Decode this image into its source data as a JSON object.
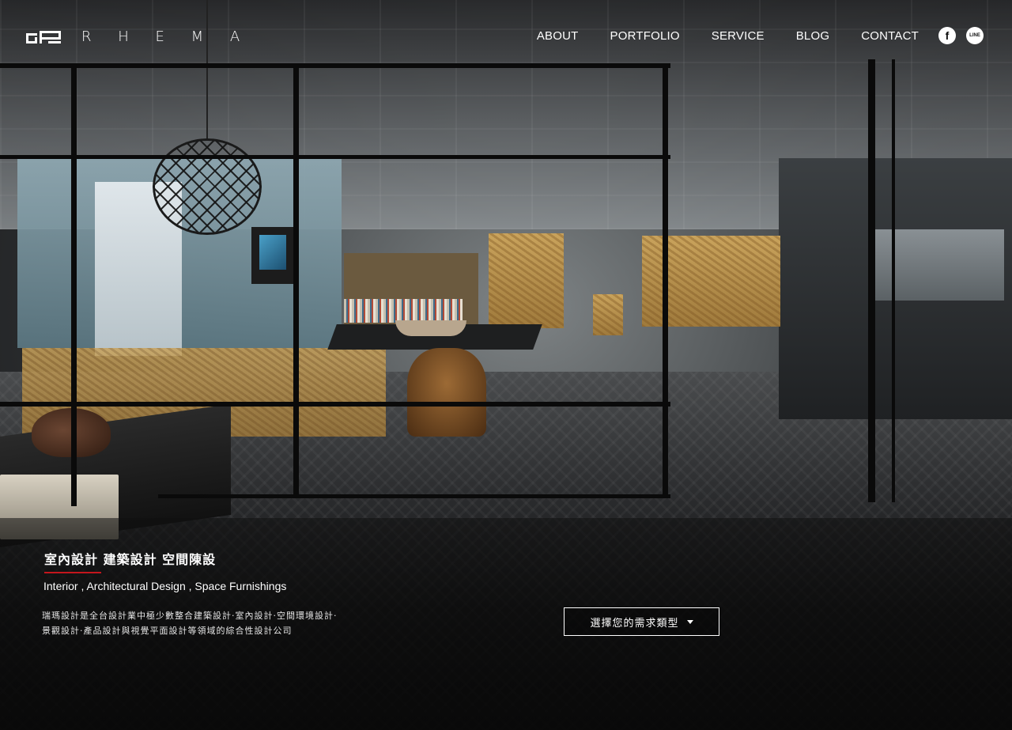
{
  "brand": {
    "logo_mark": "logo-mark",
    "name": "R H E M A"
  },
  "nav": [
    {
      "label": "ABOUT"
    },
    {
      "label": "PORTFOLIO"
    },
    {
      "label": "SERVICE"
    },
    {
      "label": "BLOG"
    },
    {
      "label": "CONTACT"
    }
  ],
  "social": {
    "facebook_icon": "facebook-icon",
    "facebook_glyph": "f",
    "line_icon": "line-icon",
    "line_glyph": "LINE"
  },
  "hero": {
    "title": "室內設計 建築設計 空間陳設",
    "subtitle": "Interior , Architectural Design , Space Furnishings",
    "description_line1": "瑞瑪設計是全台設計業中極少數整合建築設計·室內設計·空間環境設計·",
    "description_line2": "景觀設計·產品設計與視覺平面設計等領域的綜合性設計公司",
    "select_label": "選擇您的需求類型",
    "accent_color": "#c4161c"
  }
}
